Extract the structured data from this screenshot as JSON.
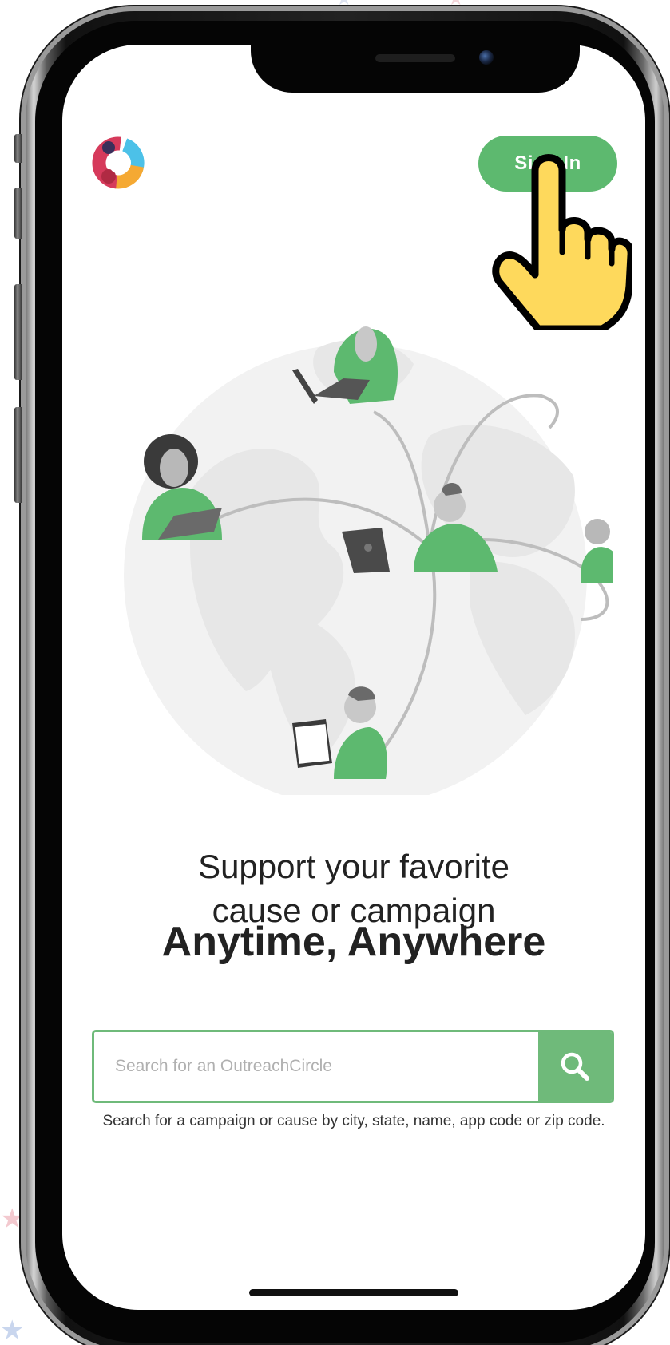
{
  "app": {
    "brand_colors": {
      "primary_green": "#5db96f",
      "search_green": "#6fba7a",
      "text_dark": "#222222"
    }
  },
  "header": {
    "logo_icon": "outreachcircle-logo-icon",
    "signin_label": "Sign In"
  },
  "hero": {
    "illustration_icon": "globe-people-illustration",
    "headline_line1": "Support your favorite",
    "headline_line2": "cause or campaign",
    "tagline": "Anytime, Anywhere"
  },
  "search": {
    "placeholder": "Search for an OutreachCircle",
    "value": "",
    "button_icon": "search-icon",
    "hint": "Search for a campaign or cause by city, state, name, app code or zip code."
  },
  "overlay": {
    "cursor_icon": "pointing-hand-cursor-icon"
  }
}
